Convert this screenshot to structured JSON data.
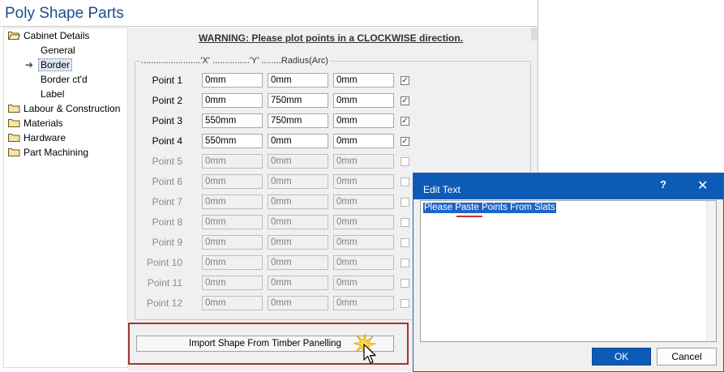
{
  "window": {
    "title": "Poly Shape Parts"
  },
  "tree": {
    "items": [
      {
        "label": "Cabinet Details"
      },
      {
        "label": "General"
      },
      {
        "label": "Border"
      },
      {
        "label": "Border ct'd"
      },
      {
        "label": "Label"
      },
      {
        "label": "Labour & Construction"
      },
      {
        "label": "Materials"
      },
      {
        "label": "Hardware"
      },
      {
        "label": "Part Machining"
      }
    ]
  },
  "panel": {
    "warning": "WARNING: Please plot points in a CLOCKWISE direction.",
    "header": "........................'X' ...............'Y' ........Radius(Arc)",
    "points": [
      {
        "label": "Point 1",
        "x": "0mm",
        "y": "0mm",
        "r": "0mm",
        "checked": true,
        "enabled": true
      },
      {
        "label": "Point 2",
        "x": "0mm",
        "y": "750mm",
        "r": "0mm",
        "checked": true,
        "enabled": true
      },
      {
        "label": "Point 3",
        "x": "550mm",
        "y": "750mm",
        "r": "0mm",
        "checked": true,
        "enabled": true
      },
      {
        "label": "Point 4",
        "x": "550mm",
        "y": "0mm",
        "r": "0mm",
        "checked": true,
        "enabled": true
      },
      {
        "label": "Point 5",
        "x": "0mm",
        "y": "0mm",
        "r": "0mm",
        "checked": false,
        "enabled": false
      },
      {
        "label": "Point 6",
        "x": "0mm",
        "y": "0mm",
        "r": "0mm",
        "checked": false,
        "enabled": false
      },
      {
        "label": "Point 7",
        "x": "0mm",
        "y": "0mm",
        "r": "0mm",
        "checked": false,
        "enabled": false
      },
      {
        "label": "Point 8",
        "x": "0mm",
        "y": "0mm",
        "r": "0mm",
        "checked": false,
        "enabled": false
      },
      {
        "label": "Point 9",
        "x": "0mm",
        "y": "0mm",
        "r": "0mm",
        "checked": false,
        "enabled": false
      },
      {
        "label": "Point 10",
        "x": "0mm",
        "y": "0mm",
        "r": "0mm",
        "checked": false,
        "enabled": false
      },
      {
        "label": "Point 11",
        "x": "0mm",
        "y": "0mm",
        "r": "0mm",
        "checked": false,
        "enabled": false
      },
      {
        "label": "Point 12",
        "x": "0mm",
        "y": "0mm",
        "r": "0mm",
        "checked": false,
        "enabled": false
      }
    ],
    "import_button": "Import Shape From Timber Panelling"
  },
  "dialog": {
    "title": "Edit Text",
    "help": "?",
    "close": "✕",
    "text": "Please Paste Points From Slats",
    "ok": "OK",
    "cancel": "Cancel"
  },
  "colors": {
    "title_text": "#1a4f8c",
    "dialog_titlebar": "#0e5bb7",
    "highlight_frame": "#a83232",
    "selection": "#1e64c8"
  },
  "icons": {
    "tree_folder": "folder-icon",
    "tree_pointer": "arrow-right-icon",
    "cursor": "mouse-pointer-icon",
    "click_burst": "click-burst-icon"
  }
}
